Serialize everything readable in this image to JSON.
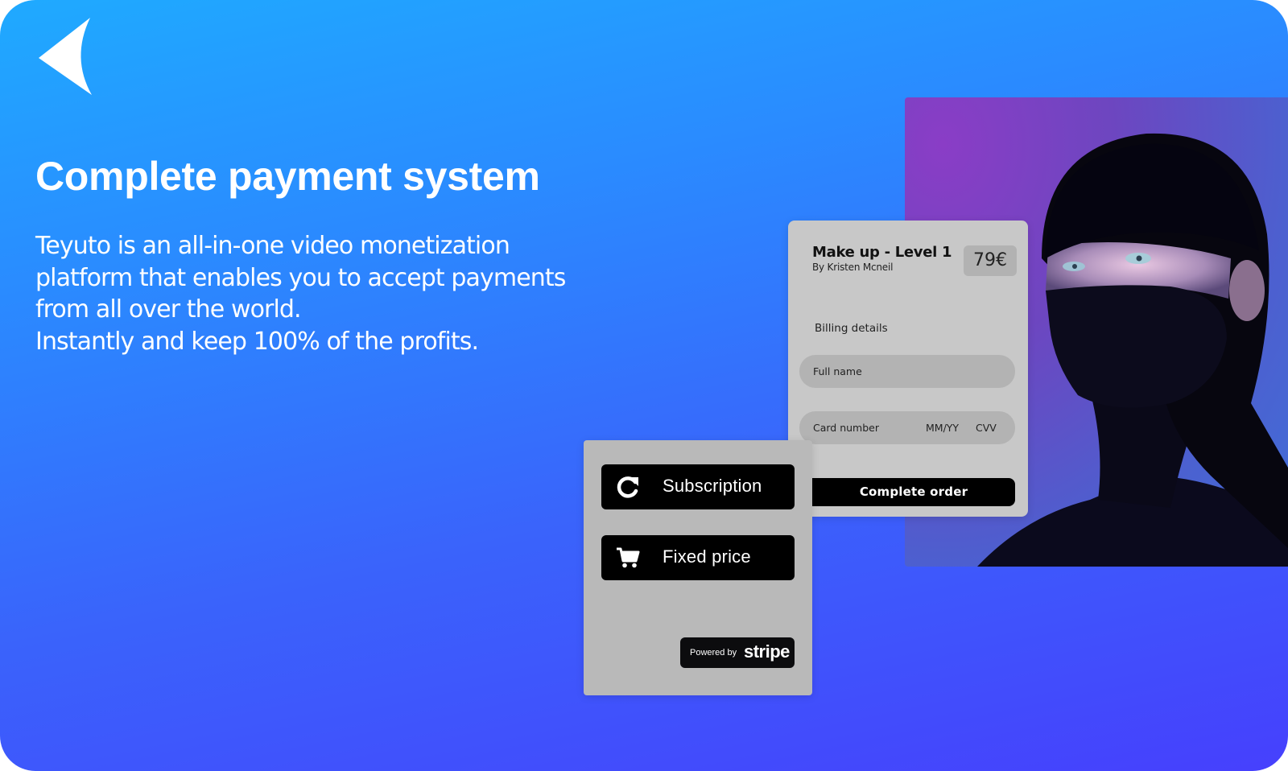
{
  "slide": {
    "title": "Complete payment system",
    "description_lines": [
      "Teyuto is an all-in-one video monetization",
      "platform that enables you to accept payments",
      "from all over the world.",
      "Instantly and keep 100% of the profits."
    ],
    "back_icon": "back-arrow-icon",
    "colors": {
      "gradient_top": "#1faaff",
      "gradient_bottom": "#4640fd",
      "card_gray": "#c8c8c8",
      "button_black": "#000000"
    }
  },
  "checkout": {
    "product_title": "Make up - Level 1",
    "product_author": "By Kristen Mcneil",
    "price": "79€",
    "billing_label": "Billing details",
    "full_name_placeholder": "Full name",
    "card_number_placeholder": "Card number",
    "expiry_placeholder": "MM/YY",
    "cvv_placeholder": "CVV",
    "complete_button": "Complete order"
  },
  "pricing": {
    "options": [
      {
        "label": "Subscription",
        "icon": "refresh-icon"
      },
      {
        "label": "Fixed price",
        "icon": "shopping-cart-icon"
      }
    ],
    "powered_by": "Powered by",
    "stripe": "stripe"
  },
  "photo": {
    "subject": "portrait-woman-blue-eyes"
  }
}
